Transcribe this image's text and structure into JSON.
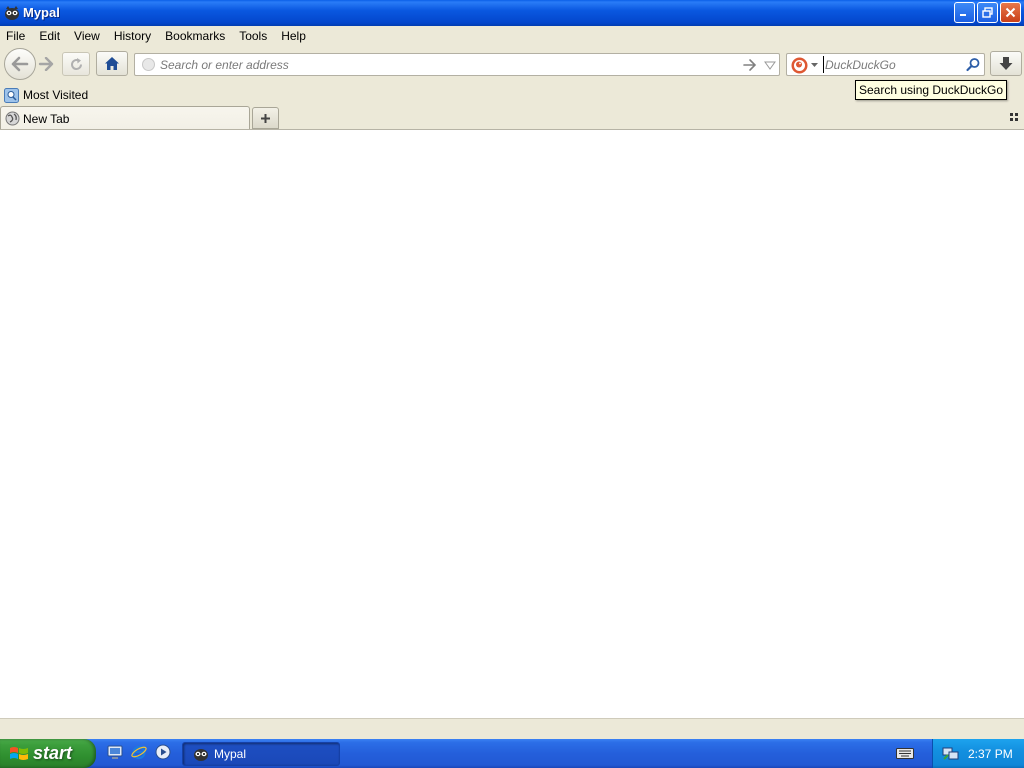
{
  "window": {
    "title": "Mypal",
    "controls": [
      "minimize",
      "maximize",
      "close"
    ]
  },
  "menubar": {
    "items": [
      "File",
      "Edit",
      "View",
      "History",
      "Bookmarks",
      "Tools",
      "Help"
    ]
  },
  "toolbar": {
    "back_icon": "back-arrow-icon",
    "forward_icon": "forward-arrow-icon",
    "reload_icon": "reload-icon",
    "home_icon": "home-icon",
    "download_icon": "download-icon"
  },
  "urlbar": {
    "placeholder": "Search or enter address",
    "value": ""
  },
  "searchbar": {
    "engine": "DuckDuckGo",
    "placeholder": "DuckDuckGo",
    "value": ""
  },
  "tooltip": {
    "text": "Search using DuckDuckGo"
  },
  "bookmarks": {
    "items": [
      "Most Visited"
    ]
  },
  "tabs": [
    {
      "label": "New Tab",
      "active": true
    }
  ],
  "taskbar": {
    "start_label": "start",
    "quick_launch": [
      "show-desktop-icon",
      "internet-explorer-icon",
      "media-player-icon"
    ],
    "tasks": [
      {
        "label": "Mypal",
        "active": true
      }
    ],
    "clock": "2:37 PM"
  },
  "colors": {
    "titlebar": "#0a58e0",
    "chrome": "#ece9d8",
    "taskbar": "#245fdb",
    "start_button": "#3c9e3c",
    "tray": "#1390e0",
    "tooltip_bg": "#ffffe1"
  }
}
